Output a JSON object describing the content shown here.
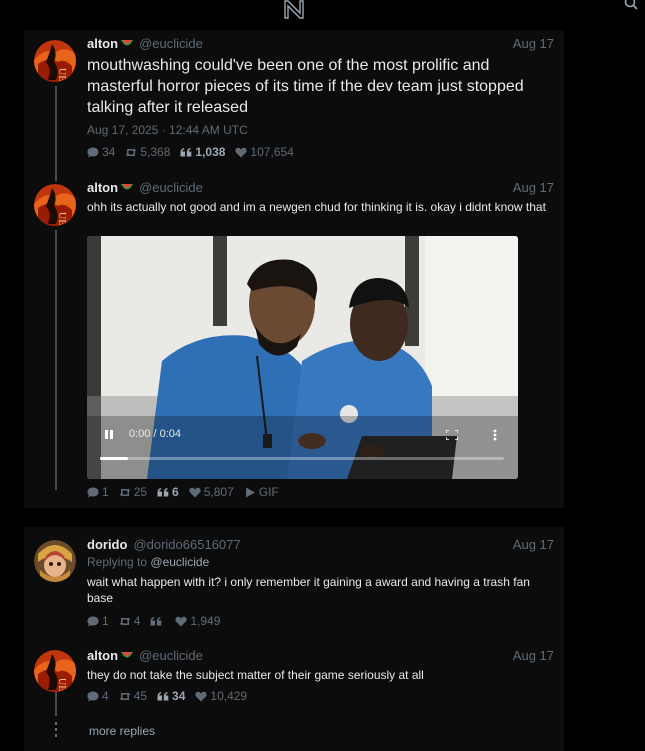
{
  "header": {
    "logo": "N"
  },
  "tweets": [
    {
      "name": "alton",
      "flag_icon": "watermelon-icon",
      "handle": "@euclicide",
      "date": "Aug 17",
      "text": "mouthwashing could've been one of the most prolific and masterful horror pieces of its time if the dev team just stopped talking after it released",
      "meta": "Aug 17, 2025 · 12:44 AM UTC",
      "stats": {
        "replies": "34",
        "retweets": "5,368",
        "quotes": "1,038",
        "likes": "107,654"
      }
    },
    {
      "name": "alton",
      "flag_icon": "watermelon-icon",
      "handle": "@euclicide",
      "date": "Aug 17",
      "text": "ohh its actually not good and im a newgen chud for thinking it is. okay i didnt know that",
      "video": {
        "time": "0:00 / 0:04",
        "progress": 0.07
      },
      "stats": {
        "replies": "1",
        "retweets": "25",
        "quotes": "6",
        "likes": "5,807",
        "gif": "GIF"
      }
    },
    {
      "name": "dorido",
      "handle": "@dorido66516077",
      "date": "Aug 17",
      "replying_to_label": "Replying to",
      "replying_to": "@euclicide",
      "text": "wait what happen with it? i only remember it gaining a award and having a trash fan base",
      "stats": {
        "replies": "1",
        "retweets": "4",
        "quotes": "",
        "likes": "1,949"
      }
    },
    {
      "name": "alton",
      "flag_icon": "watermelon-icon",
      "handle": "@euclicide",
      "date": "Aug 17",
      "text": "they do not take the subject matter of their game seriously at all",
      "stats": {
        "replies": "4",
        "retweets": "45",
        "quotes": "34",
        "likes": "10,429"
      }
    }
  ],
  "more_replies": "more replies"
}
